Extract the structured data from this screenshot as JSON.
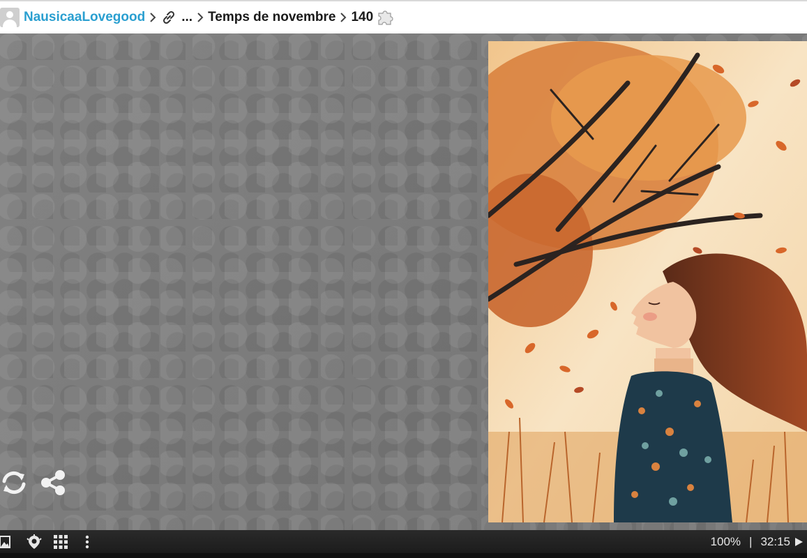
{
  "breadcrumb": {
    "user": "NausicaaLovegood",
    "ellipsis": "...",
    "album": "Temps de novembre",
    "piece_count": "140",
    "icons": [
      "avatar",
      "chevron-right-icon",
      "link-icon",
      "puzzle-piece-icon"
    ]
  },
  "board": {
    "tools": [
      "rotate-icon",
      "share-icon"
    ]
  },
  "statusbar": {
    "icons": [
      "image-icon",
      "hint-icon",
      "grid-icon",
      "menu-dots-icon",
      "play-icon"
    ],
    "zoom": "100%",
    "divider": "|",
    "time": "32:15"
  },
  "colors": {
    "link_blue": "#2a9fd0",
    "board_gray": "#7b7b7b",
    "status_bg": "#222222"
  }
}
